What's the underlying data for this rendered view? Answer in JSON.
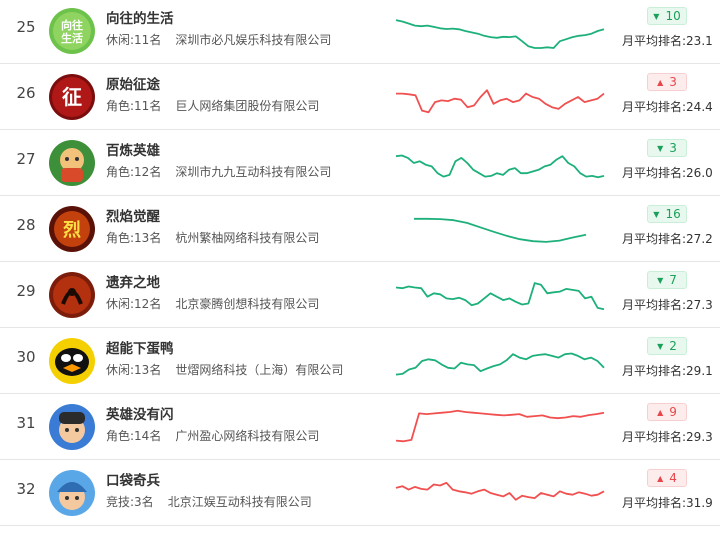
{
  "avg_prefix": "月平均排名:",
  "colors": {
    "green": "#1db07a",
    "red": "#f0504f"
  },
  "rows": [
    {
      "rank": "25",
      "name": "向往的生活",
      "category": "休闲:11名",
      "company": "深圳市必凡娱乐科技有限公司",
      "change": "10",
      "direction": "down",
      "avg": "23.1",
      "icon": "game-icon-xiangwang",
      "trend": [
        0.82,
        0.78,
        0.72,
        0.66,
        0.64,
        0.66,
        0.62,
        0.58,
        0.56,
        0.57,
        0.55,
        0.5,
        0.46,
        0.42,
        0.36,
        0.32,
        0.3,
        0.33,
        0.32,
        0.34,
        0.2,
        0.05,
        0.0,
        0.0,
        0.02,
        0.0,
        0.2,
        0.26,
        0.32,
        0.36,
        0.38,
        0.42,
        0.5,
        0.55
      ]
    },
    {
      "rank": "26",
      "name": "原始征途",
      "category": "角色:11名",
      "company": "巨人网络集团股份有限公司",
      "change": "3",
      "direction": "up",
      "avg": "24.4",
      "icon": "game-icon-yuanshi",
      "trend": [
        0.6,
        0.6,
        0.58,
        0.55,
        0.1,
        0.05,
        0.35,
        0.4,
        0.38,
        0.45,
        0.42,
        0.2,
        0.25,
        0.5,
        0.7,
        0.3,
        0.4,
        0.45,
        0.35,
        0.4,
        0.6,
        0.5,
        0.45,
        0.3,
        0.2,
        0.15,
        0.3,
        0.4,
        0.5,
        0.35,
        0.4,
        0.45,
        0.6
      ]
    },
    {
      "rank": "27",
      "name": "百炼英雄",
      "category": "角色:12名",
      "company": "深圳市九九互动科技有限公司",
      "change": "3",
      "direction": "down",
      "avg": "26.0",
      "icon": "game-icon-bailian",
      "trend": [
        0.7,
        0.72,
        0.65,
        0.5,
        0.55,
        0.45,
        0.4,
        0.2,
        0.1,
        0.15,
        0.55,
        0.65,
        0.5,
        0.3,
        0.2,
        0.1,
        0.12,
        0.2,
        0.15,
        0.3,
        0.35,
        0.2,
        0.2,
        0.25,
        0.3,
        0.4,
        0.45,
        0.6,
        0.7,
        0.5,
        0.4,
        0.2,
        0.1,
        0.12,
        0.08,
        0.12
      ]
    },
    {
      "rank": "28",
      "name": "烈焰觉醒",
      "category": "角色:13名",
      "company": "杭州繁柚网络科技有限公司",
      "change": "16",
      "direction": "down",
      "avg": "27.2",
      "icon": "game-icon-lieyan",
      "trend": [
        0.8,
        0.8,
        0.79,
        0.76,
        0.68,
        0.55,
        0.42,
        0.3,
        0.2,
        0.14,
        0.12,
        0.16,
        0.25,
        0.33
      ]
    },
    {
      "rank": "29",
      "name": "遗弃之地",
      "category": "休闲:12名",
      "company": "北京豪腾创想科技有限公司",
      "change": "7",
      "direction": "down",
      "avg": "27.3",
      "icon": "game-icon-yiqi",
      "trend": [
        0.72,
        0.7,
        0.75,
        0.72,
        0.7,
        0.45,
        0.55,
        0.52,
        0.4,
        0.38,
        0.42,
        0.35,
        0.2,
        0.25,
        0.4,
        0.55,
        0.45,
        0.35,
        0.4,
        0.3,
        0.22,
        0.25,
        0.85,
        0.8,
        0.55,
        0.58,
        0.6,
        0.68,
        0.65,
        0.62,
        0.4,
        0.45,
        0.12,
        0.08
      ]
    },
    {
      "rank": "30",
      "name": "超能下蛋鸭",
      "category": "休闲:13名",
      "company": "世熠网络科技（上海）有限公司",
      "change": "2",
      "direction": "down",
      "avg": "29.1",
      "icon": "game-icon-chaoneng",
      "trend": [
        0.1,
        0.12,
        0.25,
        0.3,
        0.5,
        0.55,
        0.52,
        0.4,
        0.3,
        0.28,
        0.45,
        0.4,
        0.38,
        0.2,
        0.28,
        0.35,
        0.4,
        0.52,
        0.7,
        0.6,
        0.55,
        0.65,
        0.68,
        0.7,
        0.65,
        0.6,
        0.7,
        0.72,
        0.65,
        0.55,
        0.6,
        0.5,
        0.3
      ]
    },
    {
      "rank": "31",
      "name": "英雄没有闪",
      "category": "角色:14名",
      "company": "广州盈心网络科技有限公司",
      "change": "9",
      "direction": "up",
      "avg": "29.3",
      "icon": "game-icon-yingxiong",
      "trend": [
        0.1,
        0.08,
        0.12,
        0.9,
        0.88,
        0.9,
        0.92,
        0.94,
        0.98,
        0.94,
        0.92,
        0.9,
        0.88,
        0.86,
        0.84,
        0.86,
        0.88,
        0.8,
        0.82,
        0.84,
        0.78,
        0.76,
        0.78,
        0.82,
        0.8,
        0.85,
        0.88,
        0.92
      ]
    },
    {
      "rank": "32",
      "name": "口袋奇兵",
      "category": "竞技:3名",
      "company": "北京江娱互动科技有限公司",
      "change": "4",
      "direction": "up",
      "avg": "31.9",
      "icon": "game-icon-koudai",
      "trend": [
        0.65,
        0.7,
        0.6,
        0.68,
        0.62,
        0.6,
        0.75,
        0.72,
        0.8,
        0.6,
        0.55,
        0.52,
        0.48,
        0.55,
        0.6,
        0.5,
        0.45,
        0.4,
        0.5,
        0.3,
        0.42,
        0.38,
        0.35,
        0.5,
        0.45,
        0.4,
        0.55,
        0.48,
        0.45,
        0.52,
        0.48,
        0.42,
        0.45,
        0.55
      ]
    }
  ]
}
